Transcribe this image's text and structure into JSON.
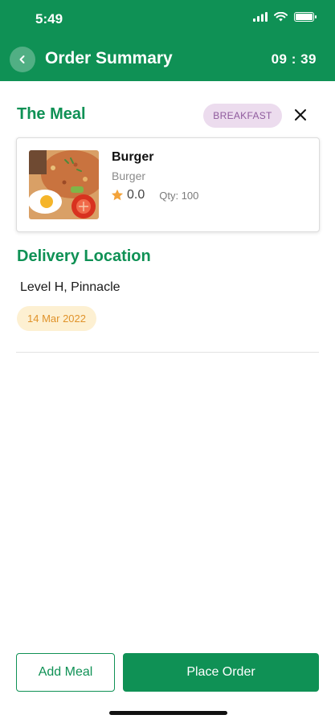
{
  "status_bar": {
    "time": "5:49"
  },
  "header": {
    "title": "Order Summary",
    "timer": "09 : 39",
    "back_icon": "chevron-left-icon"
  },
  "meal_section": {
    "title": "The Meal",
    "badge": "BREAKFAST",
    "close_icon": "close-icon"
  },
  "meal": {
    "name": "Burger",
    "subtitle": "Burger",
    "rating": "0.0",
    "quantity": "Qty: 100",
    "star_icon": "star-icon"
  },
  "delivery": {
    "title": "Delivery Location",
    "location": "Level H, Pinnacle",
    "date": "14 Mar 2022"
  },
  "actions": {
    "add_meal": "Add Meal",
    "place_order": "Place Order"
  },
  "colors": {
    "brand_green": "#0f9155",
    "badge_bg": "#ecdcee",
    "badge_text": "#8f5a9d",
    "date_bg": "#fdf0d2",
    "date_text": "#e0932b",
    "star": "#f3a33a"
  }
}
